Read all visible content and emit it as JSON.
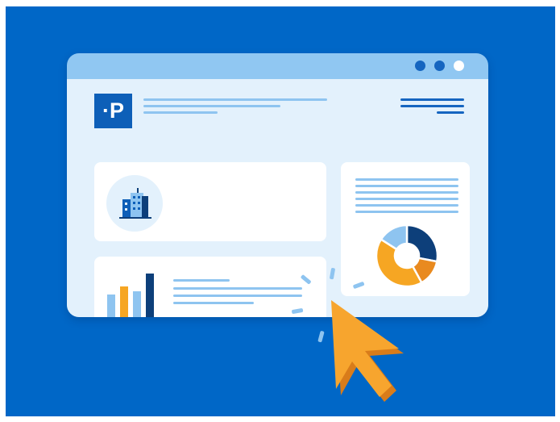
{
  "brand": {
    "logo_text": "·P"
  },
  "window_controls": [
    {
      "name": "dot-1",
      "color": "#1565C0"
    },
    {
      "name": "dot-2",
      "color": "#1565C0"
    },
    {
      "name": "dot-3",
      "color": "#FFFFFF"
    }
  ],
  "colors": {
    "background": "#0067C7",
    "titlebar": "#90C7F2",
    "window_body": "#E3F1FC",
    "card": "#FFFFFF",
    "logo_bg": "#0D5FB8",
    "text_line_light": "#8EC4F0",
    "text_line_dark": "#1565C0",
    "chart_orange": "#F6A623",
    "chart_blue_light": "#8EC4F0",
    "chart_navy": "#0D3F7A",
    "chart_dark_orange": "#E98A1F",
    "cursor": "#F7A52E",
    "cursor_shadow": "#D97C1A"
  },
  "icons": {
    "building": "building-icon",
    "cursor": "cursor-pointer-icon"
  },
  "donut": {
    "segments": [
      {
        "name": "navy",
        "fraction": 0.28,
        "color": "#0D3F7A"
      },
      {
        "name": "dark-orange",
        "fraction": 0.14,
        "color": "#E98A1F"
      },
      {
        "name": "orange",
        "fraction": 0.42,
        "color": "#F6A623"
      },
      {
        "name": "light-blue",
        "fraction": 0.16,
        "color": "#8EC4F0"
      }
    ]
  },
  "mini_bars": [
    {
      "name": "bar-1",
      "level": 0.45,
      "color": "#8EC4F0"
    },
    {
      "name": "bar-2",
      "level": 0.6,
      "color": "#F6A623"
    },
    {
      "name": "bar-3",
      "level": 0.5,
      "color": "#8EC4F0"
    },
    {
      "name": "bar-4",
      "level": 0.85,
      "color": "#0D3F7A"
    }
  ]
}
